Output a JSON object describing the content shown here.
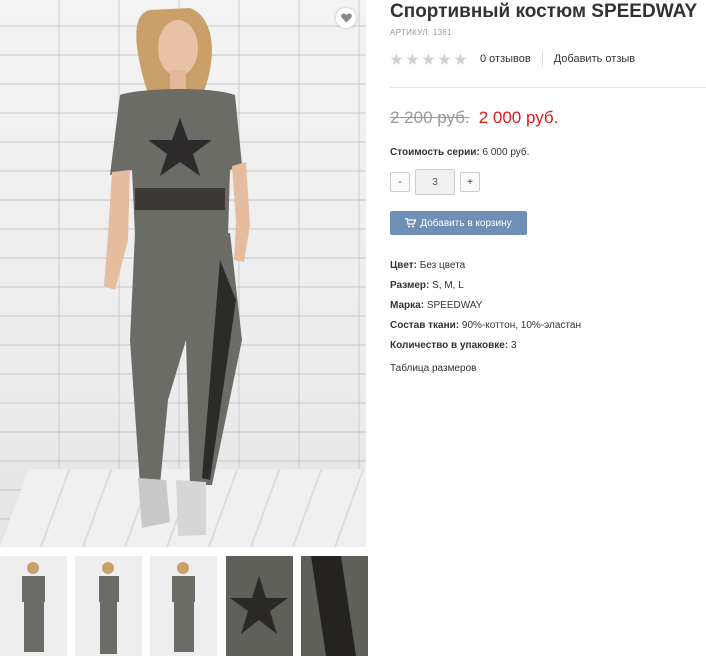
{
  "product": {
    "title": "Спортивный костюм SPEEDWAY",
    "sku_label": "Артикул:",
    "sku_value": "1361"
  },
  "rating": {
    "stars_filled": 0,
    "stars_total": 5,
    "reviews_text": "0 отзывов",
    "add_review": "Добавить отзыв"
  },
  "price": {
    "old": "2 200 руб.",
    "new": "2 000 руб."
  },
  "series": {
    "label": "Стоимость серии:",
    "value": "6 000 руб."
  },
  "quantity": {
    "minus": "-",
    "value": "3",
    "plus": "+"
  },
  "cart": {
    "label": "Добавить в корзину",
    "icon": "cart-icon"
  },
  "specs": [
    {
      "label": "Цвет:",
      "value": "Без цвета"
    },
    {
      "label": "Размер:",
      "value": "S, M, L"
    },
    {
      "label": "Марка:",
      "value": "SPEEDWAY"
    },
    {
      "label": "Состав ткани:",
      "value": "90%-коттон, 10%-эластан"
    },
    {
      "label": "Количество в упаковке:",
      "value": "3"
    }
  ],
  "size_table_link": "Таблица размеров",
  "gallery": {
    "wishlist_icon": "heart-icon",
    "thumbnail_count": 5
  },
  "colors": {
    "new_price": "#e4161c",
    "old_price": "#999999",
    "cart_button": "#6f8fb7",
    "suit_grey": "#6b6c66"
  }
}
